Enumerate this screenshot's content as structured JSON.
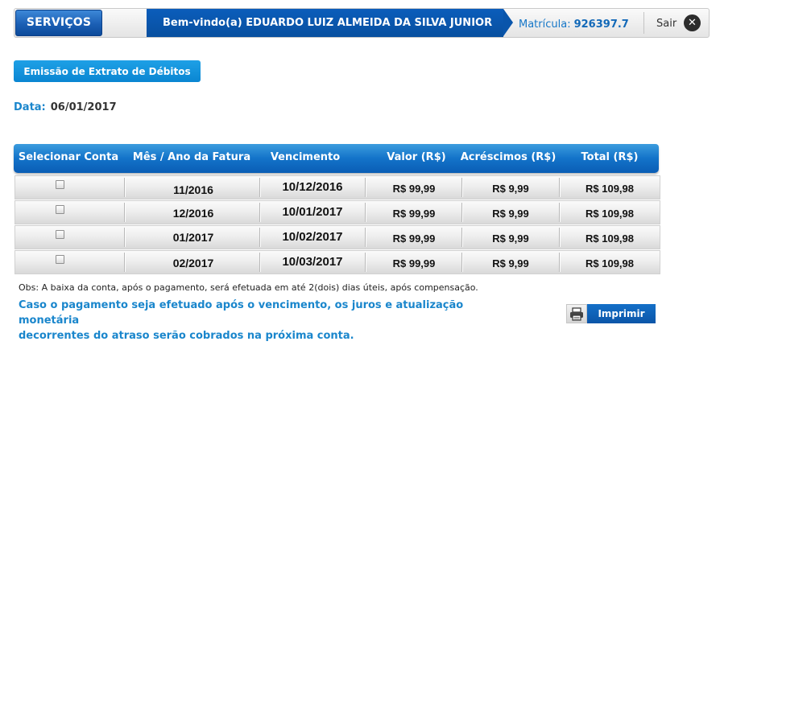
{
  "header": {
    "services_label": "SERVIÇOS",
    "welcome_text": "Bem-vindo(a) EDUARDO LUIZ ALMEIDA DA SILVA JUNIOR",
    "matricula_label": "Matrícula:",
    "matricula_value": "926397.7",
    "logout_label": "Sair",
    "logout_icon": "close-circle-icon"
  },
  "page": {
    "title": "Emissão de Extrato de Débitos",
    "date_label": "Data:",
    "date_value": "06/01/2017"
  },
  "table": {
    "columns": [
      "Selecionar Conta",
      "Mês / Ano da Fatura",
      "Vencimento",
      "Valor (R$)",
      "Acréscimos (R$)",
      "Total (R$)"
    ],
    "rows": [
      {
        "selected": false,
        "mes_ano": "11/2016",
        "vencimento": "10/12/2016",
        "valor": "R$ 99,99",
        "acrescimos": "R$ 9,99",
        "total": "R$ 109,98"
      },
      {
        "selected": false,
        "mes_ano": "12/2016",
        "vencimento": "10/01/2017",
        "valor": "R$ 99,99",
        "acrescimos": "R$ 9,99",
        "total": "R$ 109,98"
      },
      {
        "selected": false,
        "mes_ano": "01/2017",
        "vencimento": "10/02/2017",
        "valor": "R$ 99,99",
        "acrescimos": "R$ 9,99",
        "total": "R$ 109,98"
      },
      {
        "selected": false,
        "mes_ano": "02/2017",
        "vencimento": "10/03/2017",
        "valor": "R$ 99,99",
        "acrescimos": "R$ 9,99",
        "total": "R$ 109,98"
      }
    ]
  },
  "notes": {
    "obs": "Obs: A baixa da conta, após o pagamento, será efetuada em até 2(dois) dias úteis, após compensação.",
    "warning_line1": "Caso o pagamento seja efetuado após o vencimento, os juros e atualização monetária",
    "warning_line2": "decorrentes do atraso serão cobrados na próxima conta."
  },
  "actions": {
    "print_label": "Imprimir",
    "print_icon": "printer-icon"
  },
  "colors": {
    "brand_blue": "#0b5dbb",
    "accent_blue": "#1a86cc"
  }
}
